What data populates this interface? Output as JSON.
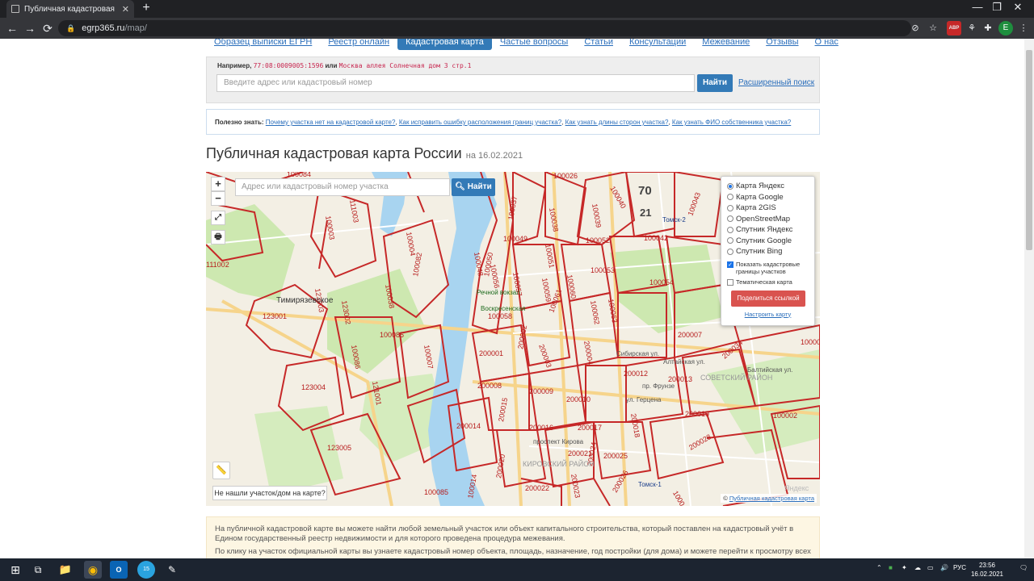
{
  "browser": {
    "tab_title": "Публичная кадастровая карта",
    "tab_close": "✕",
    "new_tab": "+",
    "url_domain": "egrp365.ru",
    "url_path": "/map/",
    "nav_back": "←",
    "nav_forward": "→",
    "nav_reload": "⟳",
    "win_minimize": "—",
    "win_restore": "❐",
    "win_close": "✕",
    "ext_badge": "ABP",
    "avatar_letter": "E"
  },
  "site_nav": [
    {
      "label": "Образец выписки ЕГРН",
      "active": false
    },
    {
      "label": "Реестр онлайн",
      "active": false
    },
    {
      "label": "Кадастровая карта",
      "active": true
    },
    {
      "label": "Частые вопросы",
      "active": false
    },
    {
      "label": "Статьи",
      "active": false
    },
    {
      "label": "Консультации",
      "active": false
    },
    {
      "label": "Межевание",
      "active": false
    },
    {
      "label": "Отзывы",
      "active": false
    },
    {
      "label": "О нас",
      "active": false
    }
  ],
  "search": {
    "example_label": "Например,",
    "example_code": "77:08:0009005:1596",
    "example_or": "или",
    "example_address": "Москва аллея Солнечная дом 3 стр.1",
    "placeholder": "Введите адрес или кадастровый номер",
    "button": "Найти",
    "advanced": "Расширенный поиск"
  },
  "tips": {
    "label": "Полезно знать:",
    "links": [
      "Почему участка нет на кадастровой карте?",
      "Как исправить ошибку расположения границ участка?",
      "Как узнать длины сторон участка?",
      "Как узнать ФИО собственника участка?"
    ]
  },
  "page": {
    "title": "Публичная кадастровая карта России",
    "date": "на 16.02.2021"
  },
  "map": {
    "zoom_in": "+",
    "zoom_out": "−",
    "fullscreen_icon": "⤢",
    "print_icon": "🖶",
    "search_placeholder": "Адрес или кадастровый номер участка",
    "search_button": "Найти",
    "layers": [
      {
        "label": "Карта Яндекс",
        "checked": true
      },
      {
        "label": "Карта Google",
        "checked": false
      },
      {
        "label": "Карта 2GIS",
        "checked": false
      },
      {
        "label": "OpenStreetMap",
        "checked": false
      },
      {
        "label": "Спутник Яндекс",
        "checked": false
      },
      {
        "label": "Спутник Google",
        "checked": false
      },
      {
        "label": "Спутник Bing",
        "checked": false
      }
    ],
    "show_borders": "Показать кадастровые границы участков",
    "show_borders_checked": true,
    "thematic": "Тематическая карта",
    "thematic_checked": false,
    "share_button": "Поделиться ссылкой",
    "setup_link": "Настроить карту",
    "ruler_icon": "📏",
    "not_found": "Не нашли участок/дом на карте?",
    "attribution_prefix": "©",
    "attribution_link": "Публичная кадастровая карта",
    "parcel_labels": [
      "100084",
      "100026",
      "100040",
      "70",
      "21",
      "100037",
      "100038",
      "100039",
      "100052",
      "100042",
      "100043",
      "100049",
      "100050",
      "100051",
      "100053",
      "100054",
      "100056",
      "100057",
      "100058",
      "100059",
      "100060",
      "100061",
      "100062",
      "100063",
      "100085",
      "100038",
      "100004",
      "100082",
      "100007",
      "123001",
      "123002",
      "123003",
      "123004",
      "123005",
      "121001",
      "100086",
      "100087",
      "200001",
      "200002",
      "200003",
      "200004",
      "200008",
      "200009",
      "200010",
      "200012",
      "200013",
      "200014",
      "200015",
      "200016",
      "200017",
      "200018",
      "200019",
      "200020",
      "200021",
      "200022",
      "200023",
      "200024",
      "200025",
      "200026",
      "200028",
      "200007",
      "200034",
      "100085",
      "100014",
      "100002",
      "100047",
      "100048",
      "100046",
      "100041",
      "100071",
      "100006",
      "100009",
      "100011",
      "100003",
      "111003",
      "111002",
      "100010",
      "300032",
      "100005"
    ],
    "place_labels": [
      "Тимирязевское",
      "ул. Ленина",
      "Северный широтный коридор",
      "Октябрьская ул.",
      "Речной вокзал",
      "Воскресенская",
      "ул. Розы",
      "Сибирская ул.",
      "Алтайская ул.",
      "СОВЕТСКИЙ РАЙОН",
      "пр. Фрунзе",
      "ул. Герцена",
      "проспект Кирова",
      "КИРОВСКИЙ РАЙОН",
      "Томск-1",
      "Томск-2",
      "Балтийская ул.",
      "пр. Ленина",
      "Кузнецова ул.",
      "Колпашевская",
      "Набережная реки Томи",
      "Клюева ул.",
      "Иркутский тракт",
      "ул. Пушкина",
      "Ярославская ул.",
      "ул. Беринга",
      "Учебная ул.",
      "ул. Суворова",
      "Красноармейская",
      "Советская ул.",
      "Вершинина ул.",
      "Пирогова ул.",
      "2-й Иркутский пр.",
      "ул. Некрасова",
      "Тверская ул.",
      "Карьерная ул.",
      "Яндекс"
    ]
  },
  "info": {
    "p1": "На публичной кадастровой карте вы можете найти любой земельный участок или объект капитального строительства, который поставлен на кадастровый учёт в Едином государственный реестр недвижимости и для которого проведена процедура межевания.",
    "p2": "По клику на участок официальной карты вы узнаете кадастровый номер объекта, площадь, назначение, год постройки (для дома) и можете перейти к просмотру всех"
  },
  "taskbar": {
    "start_icon": "⊞",
    "taskview_icon": "⧉",
    "explorer_icon": "📁",
    "chrome_icon": "◉",
    "outlook_icon": "O",
    "telegram_badge": "15",
    "lang": "РУС",
    "time": "23:56",
    "date": "16.02.2021"
  },
  "colors": {
    "link": "#2a6ebb",
    "primary": "#337ab7",
    "share": "#d9534f",
    "parcel_border": "#c62828",
    "river": "#a8d4f0",
    "park": "#cde8b0"
  }
}
